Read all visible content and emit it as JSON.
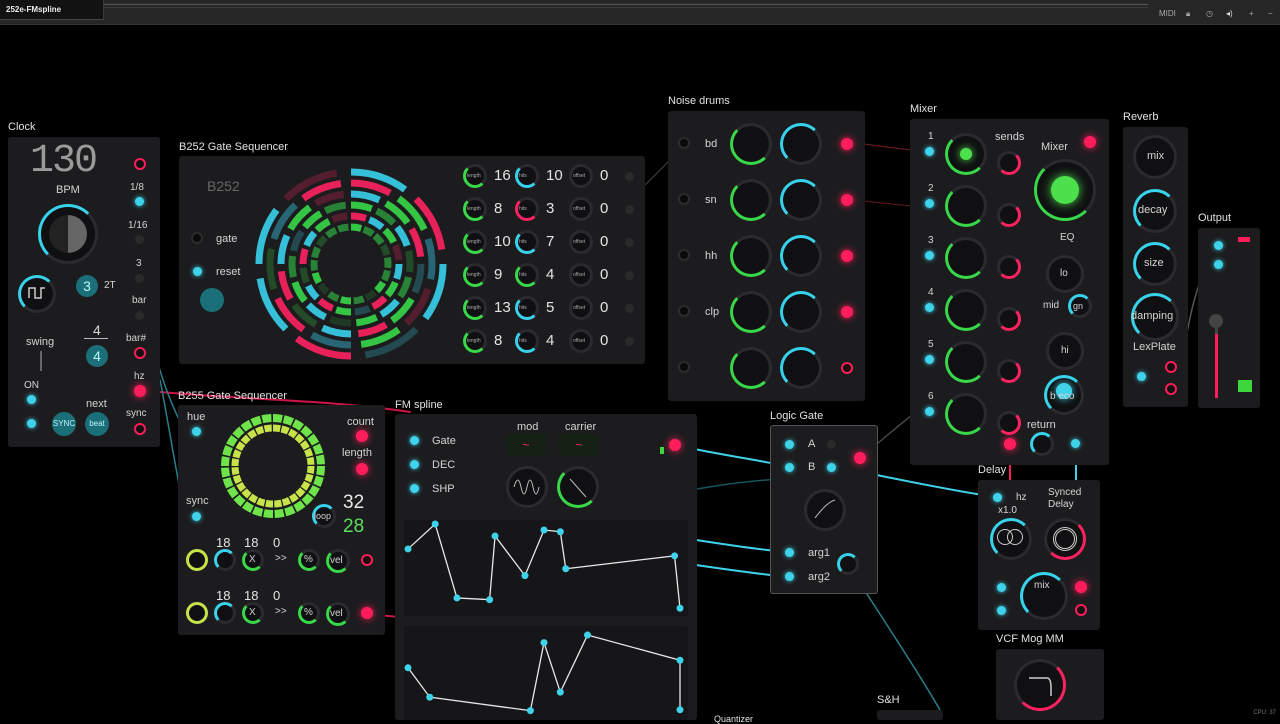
{
  "window": {
    "title": "252e-FMspline",
    "midi": "MIDI",
    "cpu": "CPU: 37"
  },
  "colors": {
    "cyan": "#38d2ec",
    "green": "#38d848",
    "pink": "#ff1c5a",
    "panel": "#1c1c1e"
  },
  "icons": [
    "lock-icon",
    "clock-icon",
    "speaker-icon",
    "plus-icon",
    "minus-icon"
  ],
  "clock": {
    "title": "Clock",
    "bpm_value": "130",
    "bpm_label": "BPM",
    "div1": "1/8",
    "div2": "1/16",
    "div3": "3",
    "bar": "bar",
    "barnum": "bar#",
    "hz": "hz",
    "sync": "sync",
    "triplet_n": "3",
    "triplet_label": "2T",
    "swing": "swing",
    "sig_top": "4",
    "sig_bottom": "4",
    "on": "ON",
    "next": "next",
    "sync_btn": "SYNC",
    "beat_btn": "beat"
  },
  "b252": {
    "title": "B252 Gate Sequencer",
    "logo": "B252",
    "gate": "gate",
    "reset": "reset",
    "length_label": "length",
    "hits_label": "hits",
    "offset_label": "offset",
    "rows": [
      {
        "length": "16",
        "hits": "10",
        "offset": "0"
      },
      {
        "length": "8",
        "hits": "3",
        "offset": "0"
      },
      {
        "length": "10",
        "hits": "7",
        "offset": "0"
      },
      {
        "length": "9",
        "hits": "4",
        "offset": "0"
      },
      {
        "length": "13",
        "hits": "5",
        "offset": "0"
      },
      {
        "length": "8",
        "hits": "4",
        "offset": "0"
      }
    ]
  },
  "noise": {
    "title": "Noise drums",
    "voices": [
      "bd",
      "sn",
      "hh",
      "clp",
      ""
    ]
  },
  "mixer": {
    "title": "Mixer",
    "channels": [
      "1",
      "2",
      "3",
      "4",
      "5",
      "6"
    ],
    "sends": "sends",
    "mixer": "Mixer",
    "eq": "EQ",
    "lo": "lo",
    "mid": "mid",
    "gn": "gn",
    "hi": "hi",
    "bpeco": "b eco",
    "return": "return"
  },
  "reverb": {
    "title": "Reverb",
    "mix": "mix",
    "decay": "decay",
    "size": "size",
    "damping": "damping",
    "lexplate": "LexPlate"
  },
  "output": {
    "title": "Output"
  },
  "b255": {
    "title": "B255 Gate Sequencer",
    "hue": "hue",
    "count": "count",
    "length": "length",
    "sync": "sync",
    "loop": "loop",
    "count_value": "32",
    "length_value": "28",
    "rows": [
      {
        "a": "18",
        "b": "18",
        "c": "0",
        "x": "X",
        "arrows": ">>",
        "pct": "%",
        "vel": "vel"
      },
      {
        "a": "18",
        "b": "18",
        "c": "0",
        "x": "X",
        "arrows": ">>",
        "pct": "%",
        "vel": "vel"
      }
    ]
  },
  "fm": {
    "title": "FM spline",
    "gate": "Gate",
    "dec": "DEC",
    "shp": "SHP",
    "mod": "mod",
    "carrier": "carrier",
    "spline1": [
      [
        0.0,
        0.29
      ],
      [
        0.1,
        0.0
      ],
      [
        0.18,
        0.86
      ],
      [
        0.3,
        0.88
      ],
      [
        0.32,
        0.14
      ],
      [
        0.43,
        0.6
      ],
      [
        0.5,
        0.07
      ],
      [
        0.56,
        0.09
      ],
      [
        0.58,
        0.52
      ],
      [
        0.98,
        0.37
      ],
      [
        1.0,
        0.98
      ]
    ],
    "spline2": [
      [
        0.0,
        0.45
      ],
      [
        0.08,
        0.8
      ],
      [
        0.45,
        0.96
      ],
      [
        0.5,
        0.15
      ],
      [
        0.56,
        0.74
      ],
      [
        0.66,
        0.06
      ],
      [
        1.0,
        0.36
      ],
      [
        1.0,
        0.95
      ]
    ]
  },
  "logic": {
    "title": "Logic Gate",
    "a": "A",
    "b": "B",
    "arg1": "arg1",
    "arg2": "arg2"
  },
  "delay": {
    "title": "Delay",
    "hz": "hz",
    "x10": "x1.0",
    "synced": "Synced",
    "delay": "Delay",
    "mix": "mix"
  },
  "vcf": {
    "title": "VCF Mog MM"
  },
  "sh": {
    "title": "S&H"
  },
  "quantizer": {
    "title": "Quantizer"
  }
}
